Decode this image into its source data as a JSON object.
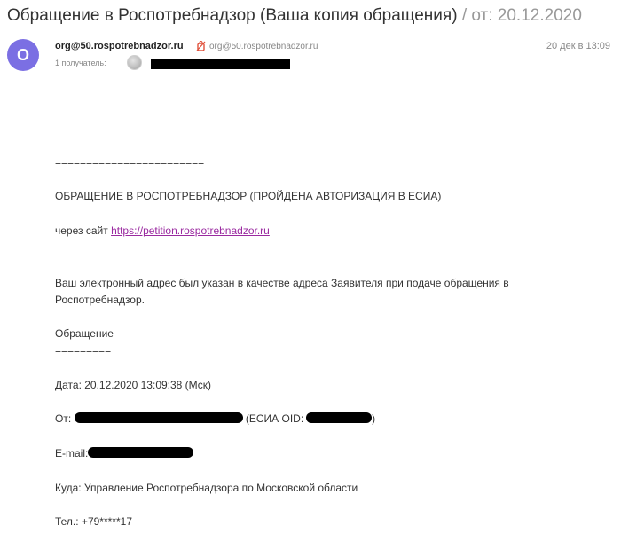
{
  "subject": {
    "title": "Обращение в Роспотребнадзор (Ваша копия обращения)",
    "separator": "/ от:",
    "date": "20.12.2020"
  },
  "sender": {
    "avatar_letter": "O",
    "avatar_color": "#7b6fe3",
    "name": "org@50.rospotrebnadzor.ru",
    "address": "org@50.rospotrebnadzor.ru",
    "time": "20 дек в 13:09"
  },
  "recipients": {
    "label": "1 получатель:"
  },
  "body": {
    "divider1": "========================",
    "heading": "ОБРАЩЕНИЕ В РОСПОТРЕБНАДЗОР (ПРОЙДЕНА АВТОРИЗАЦИЯ В ЕСИА)",
    "via_prefix": "через сайт",
    "via_link": "https://petition.rospotrebnadzor.ru",
    "notice": "Ваш электронный адрес был указан в качестве адреса Заявителя при подаче обращения в Роспотребнадзор.",
    "appeal_title": "Обращение",
    "divider2": "=========",
    "date_line": "Дата: 20.12.2020 13:09:38 (Мск)",
    "from_label": "От:",
    "esia_prefix": "(ЕСИА OID:",
    "esia_suffix": ")",
    "email_label": "E-mail:",
    "to_line": "Куда: Управление Роспотребнадзора по Московской области",
    "phone_line": "Тел.: +79*****17"
  },
  "colors": {
    "link": "#9a2aa0",
    "muted": "#999999",
    "accent_icon": "#e0533d"
  }
}
